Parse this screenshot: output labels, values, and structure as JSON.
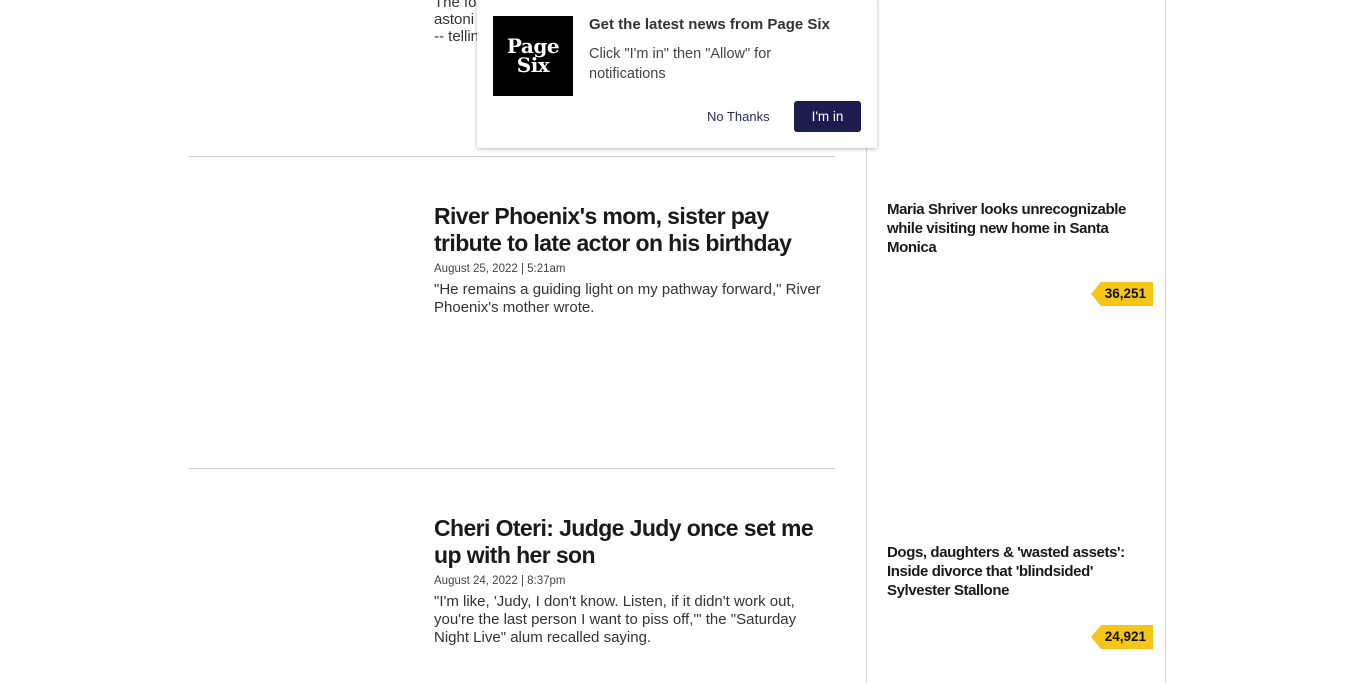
{
  "articles": [
    {
      "title": "River Phoenix's mom, sister pay tribute to late actor on his birthday",
      "date": "August 25, 2022 | 5:21am",
      "excerpt": "\"He remains a guiding light on my pathway forward,\" River Phoenix's mother wrote."
    },
    {
      "title": "Cheri Oteri: Judge Judy once set me up with her son",
      "date": "August 24, 2022 | 8:37pm",
      "excerpt": "\"I'm like, 'Judy, I don't know. Listen, if it didn't work out, you're the last person I want to piss off,'\" the \"Saturday Night Live\" alum recalled saying."
    }
  ],
  "partial_excerpt": {
    "line1": "The fo",
    "line2": "astoni",
    "line3": "-- tellin"
  },
  "sidebar": {
    "stories": [
      {
        "title": "Maria Shriver looks unrecognizable while visiting new home in Santa Monica",
        "count": "36,251"
      },
      {
        "title": "Dogs, daughters & 'wasted assets': Inside divorce that 'blindsided' Sylvester Stallone",
        "count": "24,921"
      }
    ]
  },
  "popup": {
    "logo_line1": "Page",
    "logo_line2": "Six",
    "title": "Get the latest news from Page Six",
    "body": "Click \"I'm in\" then \"Allow\" for notifications",
    "decline_label": "No Thanks",
    "accept_label": "I'm in"
  },
  "colors": {
    "badge": "#f5c518",
    "accept_button": "#1e1b4d",
    "divider": "#cfcfcf"
  }
}
